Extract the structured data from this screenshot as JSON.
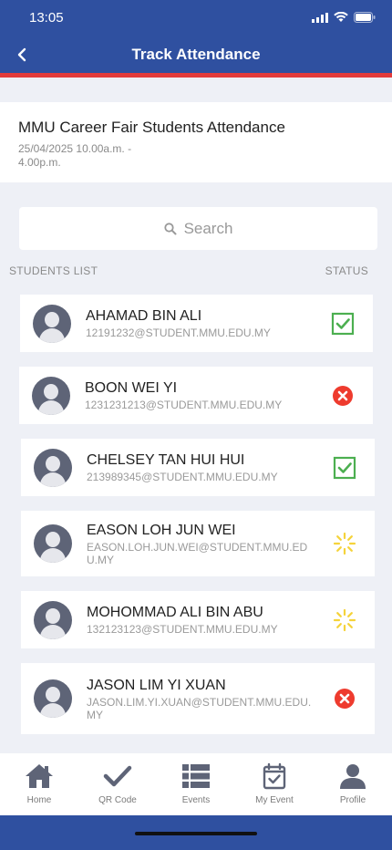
{
  "status_bar": {
    "time": "13:05"
  },
  "header": {
    "title": "Track Attendance"
  },
  "event": {
    "title": "MMU Career Fair Students Attendance",
    "date": "25/04/2025 10.00a.m. - 4.00p.m."
  },
  "search": {
    "placeholder": "Search"
  },
  "list": {
    "left_label": "STUDENTS LIST",
    "right_label": "STATUS"
  },
  "students": [
    {
      "name": "AHAMAD BIN ALI",
      "email": "12191232@STUDENT.MMU.EDU.MY",
      "status": "present"
    },
    {
      "name": "BOON WEI YI",
      "email": "1231231213@STUDENT.MMU.EDU.MY",
      "status": "absent"
    },
    {
      "name": "CHELSEY TAN HUI HUI",
      "email": "213989345@STUDENT.MMU.EDU.MY",
      "status": "present"
    },
    {
      "name": "EASON LOH JUN WEI",
      "email": "EASON.LOH.JUN.WEI@STUDENT.MMU.EDU.MY",
      "status": "pending"
    },
    {
      "name": "MOHOMMAD ALI BIN ABU",
      "email": "132123123@STUDENT.MMU.EDU.MY",
      "status": "pending"
    },
    {
      "name": "JASON LIM YI XUAN",
      "email": "JASON.LIM.YI.XUAN@STUDENT.MMU.EDU.MY",
      "status": "absent"
    }
  ],
  "nav": [
    {
      "label": "Home",
      "icon": "home-icon"
    },
    {
      "label": "QR Code",
      "icon": "checkmark-icon"
    },
    {
      "label": "Events",
      "icon": "list-icon"
    },
    {
      "label": "My Event",
      "icon": "calendar-check-icon"
    },
    {
      "label": "Profile",
      "icon": "user-icon"
    }
  ],
  "colors": {
    "header": "#2f50a0",
    "accent_red": "#e23b3b",
    "present": "#4caf50",
    "absent": "#ee3b2e",
    "pending": "#f5d33b",
    "nav_icon": "#5e6477"
  }
}
